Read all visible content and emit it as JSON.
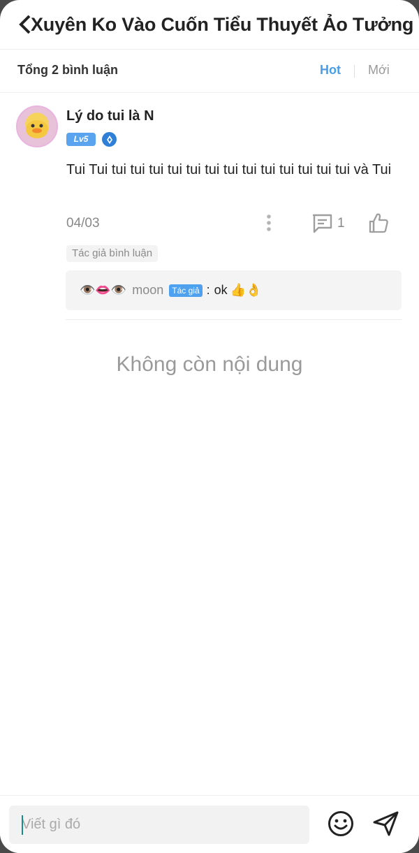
{
  "header": {
    "title": "Xuyên Ko Vào Cuốn Tiểu Thuyết Ảo Tưởng",
    "back_icon": "chevron-left-icon"
  },
  "comments_bar": {
    "total_label": "Tổng 2 bình luận",
    "sort_hot": "Hot",
    "sort_new": "Mới",
    "active_sort": "Hot",
    "accent_color": "#4a9de8"
  },
  "comment": {
    "username": "Lý do tui là N",
    "level": "Lv5",
    "text": "Tui Tui tui tui tui tui tui tui tui tui tui tui tui tui tui và Tui",
    "date": "04/03",
    "reply_count": "1",
    "author_liked_tag": "Tác giả bình luận",
    "reply": {
      "emoji_prefix": "👁️👄👁️",
      "name": "moon",
      "author_chip": "Tác giả",
      "separator": ":",
      "text": "ok",
      "emoji_suffix": "👍👌"
    }
  },
  "end_message": "Không còn nội dung",
  "composer": {
    "placeholder": "Viết gì đó",
    "value": ""
  }
}
